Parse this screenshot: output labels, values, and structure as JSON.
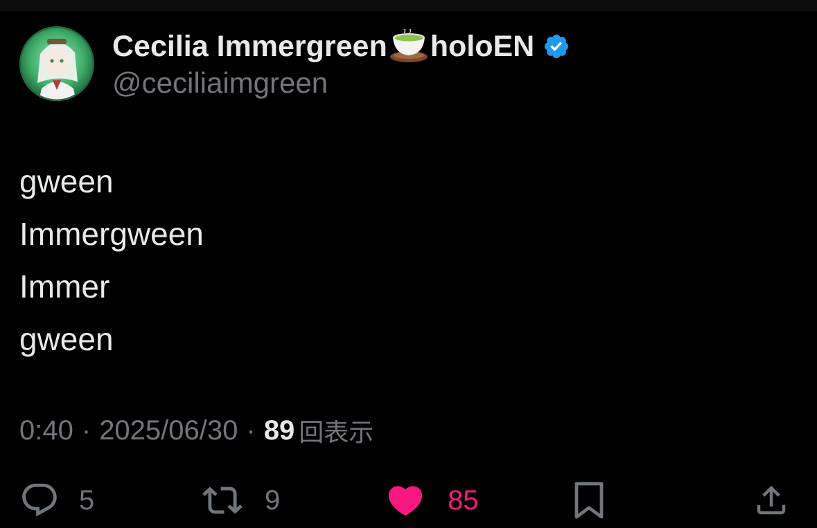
{
  "author": {
    "display_name": "Cecilia Immergreen",
    "display_suffix": "holoEN",
    "handle": "@ceciliaimgreen",
    "verified": true,
    "name_emoji": "tea-icon"
  },
  "tweet": {
    "lines": [
      "gween",
      "Immergween",
      "Immer",
      "gween"
    ]
  },
  "meta": {
    "time": "0:40",
    "separator": "·",
    "date": "2025/06/30",
    "views_count": "89",
    "views_label": "回表示"
  },
  "actions": {
    "replies": "5",
    "retweets": "9",
    "likes": "85"
  },
  "colors": {
    "background": "#000000",
    "primary_text": "#e7e9ea",
    "secondary_text": "#71767b",
    "like": "#f91880",
    "verified": "#1d9bf0"
  }
}
